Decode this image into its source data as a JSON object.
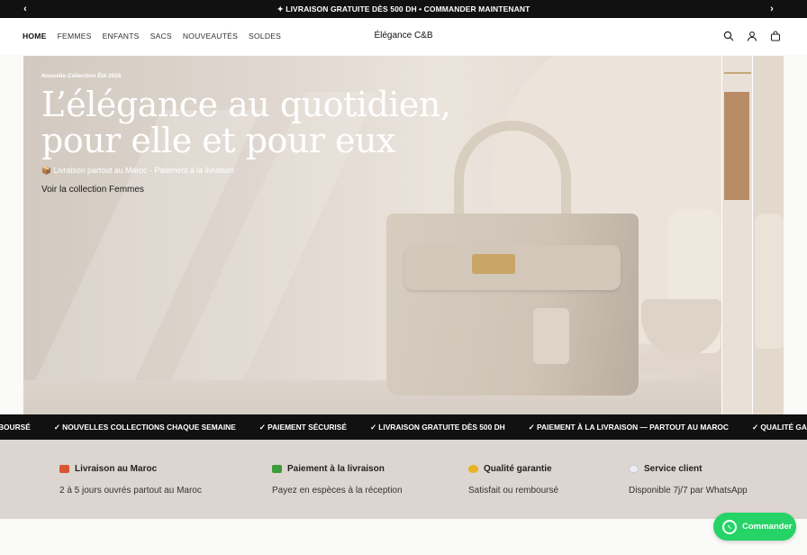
{
  "announcement": {
    "text": "✦ LIVRAISON GRATUITE DÈS 500 DH • COMMANDER MAINTENANT",
    "prev_icon": "chevron-left-icon",
    "next_icon": "chevron-right-icon"
  },
  "header": {
    "nav": [
      "HOME",
      "FEMMES",
      "ENFANTS",
      "SACS",
      "NOUVEAUTÉS",
      "SOLDES"
    ],
    "active_nav": "HOME",
    "brand": "Élégance C&B",
    "icons": [
      "search-icon",
      "account-icon",
      "cart-icon"
    ]
  },
  "hero": {
    "eyebrow": "Nouvelle Collection Été 2026",
    "headline_line1": "L’élégance au quotidien,",
    "headline_line2": "pour elle et pour eux",
    "subline": "📦 Livraison partout au Maroc · Paiement à la livraison",
    "cta": "Voir la collection Femmes"
  },
  "marquee": {
    "items": [
      "MBOURSÉ",
      "✓ NOUVELLES COLLECTIONS CHAQUE SEMAINE",
      "✓ PAIEMENT SÉCURISÉ",
      "✓ LIVRAISON GRATUITE DÈS 500 DH",
      "✓ PAIEMENT À LA LIVRAISON — PARTOUT AU MAROC",
      "✓ QUALITÉ GARANTIE — SATISFAIT OU REMBOU"
    ]
  },
  "features": [
    {
      "title": "Livraison au Maroc",
      "desc": "2 à 5 jours ouvrés partout au Maroc",
      "icon": "truck-icon",
      "color": "#d9552f"
    },
    {
      "title": "Paiement à la livraison",
      "desc": "Payez en espèces à la réception",
      "icon": "cash-icon",
      "color": "#3f9a3a"
    },
    {
      "title": "Qualité garantie",
      "desc": "Satisfait ou remboursé",
      "icon": "sparkle-icon",
      "color": "#e6b323"
    },
    {
      "title": "Service client",
      "desc": "Disponible 7j/7 par WhatsApp",
      "icon": "chat-bubble-icon",
      "color": "#e8e8ee"
    }
  ],
  "whatsapp": {
    "label": "Commander",
    "icon": "whatsapp-icon"
  }
}
